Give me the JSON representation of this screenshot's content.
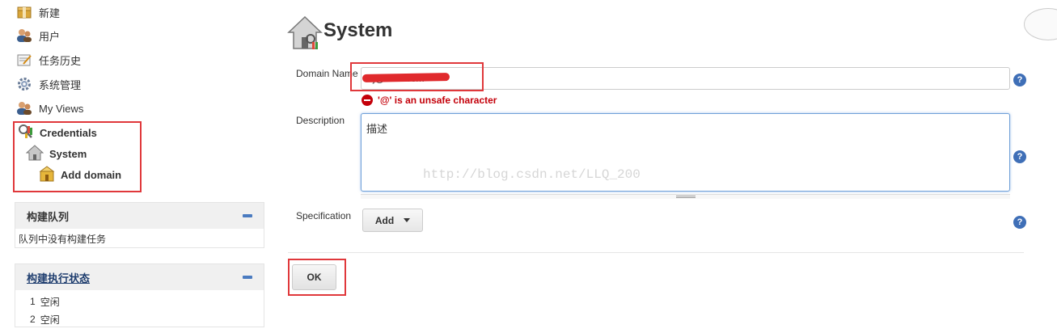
{
  "sidebar": {
    "items": [
      {
        "label": "新建",
        "icon": "new-package-icon"
      },
      {
        "label": "用户",
        "icon": "users-icon"
      },
      {
        "label": "任务历史",
        "icon": "notepad-icon"
      },
      {
        "label": "系统管理",
        "icon": "gear-icon"
      },
      {
        "label": "My Views",
        "icon": "users-icon"
      }
    ],
    "credentials": {
      "label": "Credentials",
      "system": "System",
      "add_domain": "Add domain"
    },
    "build_queue": {
      "title": "构建队列",
      "empty": "队列中没有构建任务"
    },
    "executor_status": {
      "title": "构建执行状态",
      "executors": [
        {
          "number": "1",
          "state": "空闲"
        },
        {
          "number": "2",
          "state": "空闲"
        }
      ]
    }
  },
  "main": {
    "title": "System",
    "domain_label": "Domain Name",
    "domain_value": "lilj@l      .com",
    "domain_visible_suffix": "com",
    "error_text": "'@' is an unsafe character",
    "description_label": "Description",
    "description_value": "描述",
    "watermark": "http://blog.csdn.net/LLQ_200",
    "specification_label": "Specification",
    "add_label": "Add",
    "ok_label": "OK",
    "help_glyph": "?"
  },
  "colors": {
    "highlight": "#e0383b",
    "error": "#c4000a",
    "help": "#3f6fb7",
    "focus": "#6fa0d8"
  }
}
